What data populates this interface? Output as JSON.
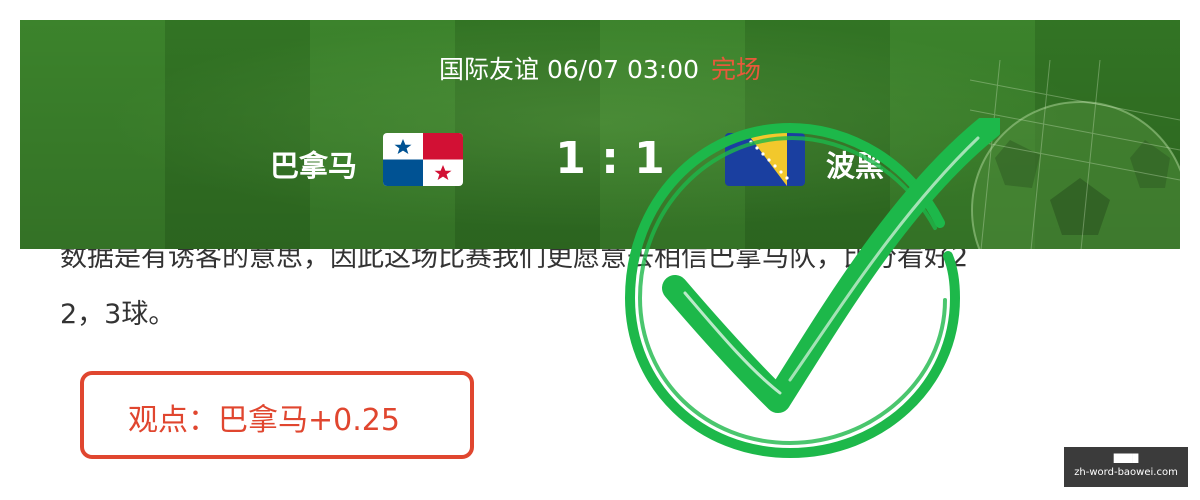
{
  "match": {
    "competition": "国际友谊",
    "datetime": "06/07 03:00",
    "status": "完场",
    "home_team": "巴拿马",
    "away_team": "波黑",
    "score": "1 : 1",
    "home_flag": "panama-flag-icon",
    "away_flag": "bosnia-flag-icon"
  },
  "article": {
    "line1": "数据是有诱客的意思，因此这场比赛我们更愿意去相信巴拿马队，比分看好2",
    "line2": "2，3球。"
  },
  "opinion": {
    "text": "观点：巴拿马+0.25"
  },
  "stamp": {
    "icon": "check-mark-icon",
    "color": "#1db84a"
  },
  "watermark": {
    "title": "████",
    "url": "zh-word-baowei.com"
  },
  "colors": {
    "status": "#e8593b",
    "opinion_border": "#e0462f",
    "pitch_green": "#3f8a2e"
  }
}
